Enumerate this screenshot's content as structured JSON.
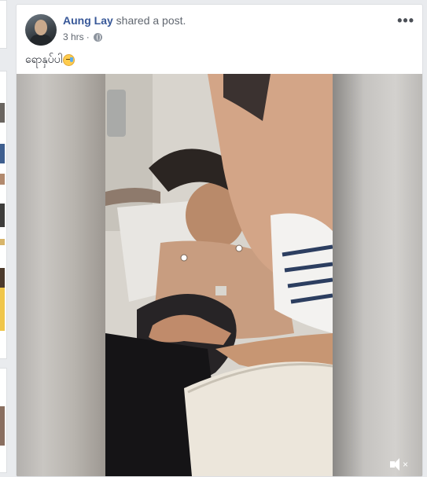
{
  "post": {
    "author": "Aung Lay",
    "action": "shared a post.",
    "time": "3 hrs",
    "privacy_icon": "globe-icon",
    "more_label": "•••",
    "text": "ရောနှပ်ပါ"
  },
  "video": {
    "muted": true,
    "volume_icon": "speaker-muted-icon",
    "volume_symbol": "×"
  },
  "colors": {
    "author_link": "#385898",
    "page_bg": "#e9ebee",
    "card_border": "#dddfe2"
  }
}
